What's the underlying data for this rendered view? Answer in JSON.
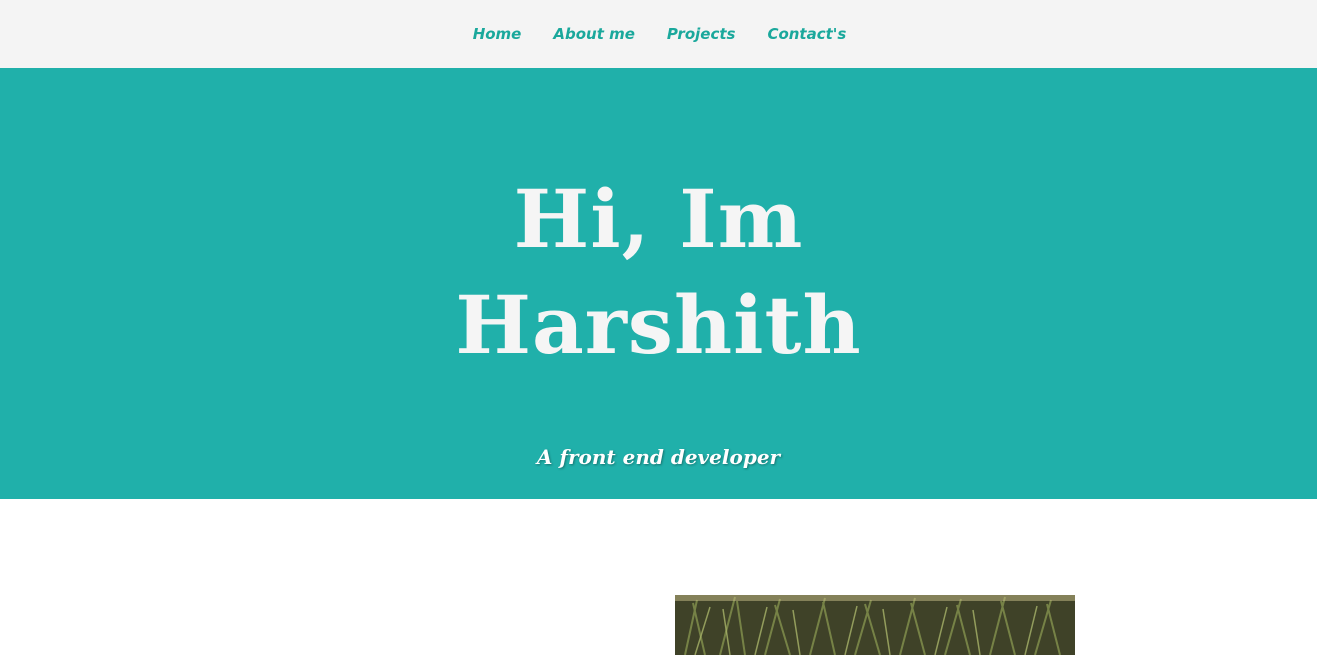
{
  "nav": {
    "items": [
      {
        "label": "Home"
      },
      {
        "label": "About me"
      },
      {
        "label": "Projects"
      },
      {
        "label": "Contact's"
      }
    ]
  },
  "hero": {
    "title_line1": "Hi, Im",
    "title_line2": "Harshith",
    "subtitle": "A front end developer"
  },
  "colors": {
    "accent": "#20b0aa",
    "nav_text": "#1aa89c",
    "nav_background": "#f4f4f4",
    "hero_text": "#f5f5f5"
  },
  "about": {
    "photo_icon": "profile-photo"
  }
}
